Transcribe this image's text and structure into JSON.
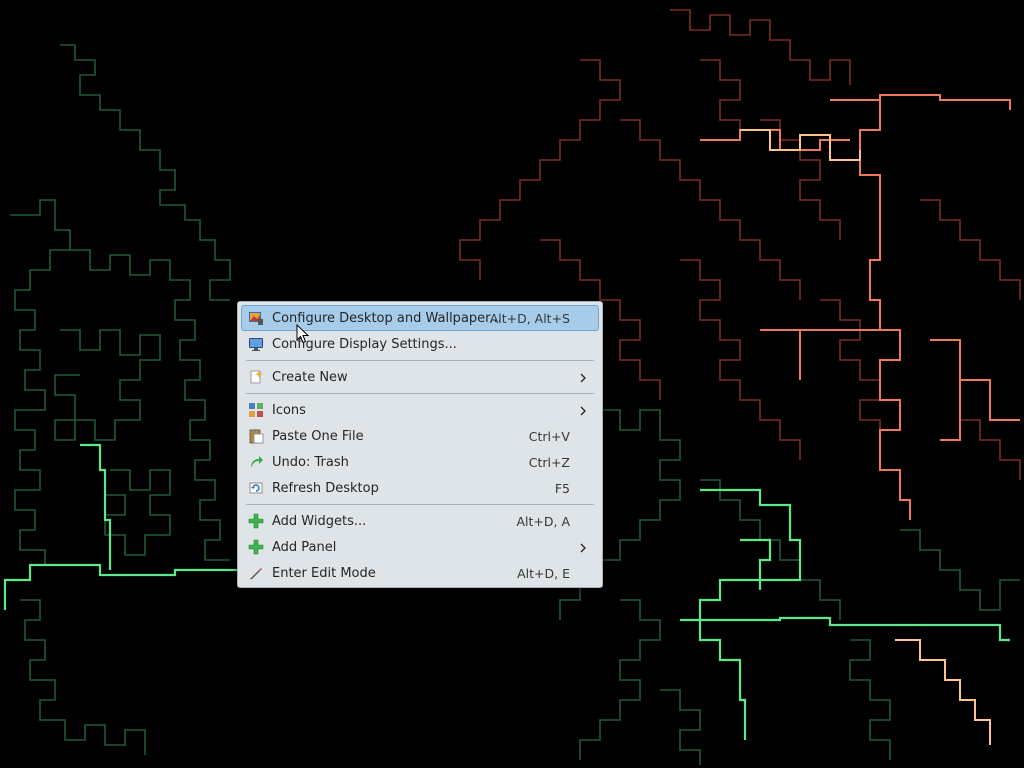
{
  "desktop": {
    "background_color": "#000000",
    "wallpaper": "maze-pattern"
  },
  "context_menu": {
    "items": [
      {
        "label": "Configure Desktop and Wallpaper...",
        "shortcut": "Alt+D, Alt+S",
        "icon": "configure-desktop-icon"
      },
      {
        "label": "Configure Display Settings...",
        "shortcut": "",
        "icon": "display-icon"
      },
      {
        "label": "Create New",
        "shortcut": "",
        "icon": "create-new-icon"
      },
      {
        "label": "Icons",
        "shortcut": "",
        "icon": "icons-icon"
      },
      {
        "label": "Paste One File",
        "shortcut": "Ctrl+V",
        "icon": "paste-icon"
      },
      {
        "label": "Undo: Trash",
        "shortcut": "Ctrl+Z",
        "icon": "undo-icon"
      },
      {
        "label": "Refresh Desktop",
        "shortcut": "F5",
        "icon": "refresh-icon"
      },
      {
        "label": "Add Widgets...",
        "shortcut": "Alt+D, A",
        "icon": "add-widgets-icon"
      },
      {
        "label": "Add Panel",
        "shortcut": "",
        "icon": "add-panel-icon"
      },
      {
        "label": "Enter Edit Mode",
        "shortcut": "Alt+D, E",
        "icon": "edit-mode-icon"
      }
    ],
    "highlight_color": "#a7ccea",
    "background_color": "#dfe4e8"
  },
  "wallpaper_colors": {
    "green_dim": "#1f5a35",
    "green_bright": "#5fe88a",
    "red_dim": "#7a2e22",
    "red_bright": "#f0785a",
    "peach": "#ffc48a"
  }
}
